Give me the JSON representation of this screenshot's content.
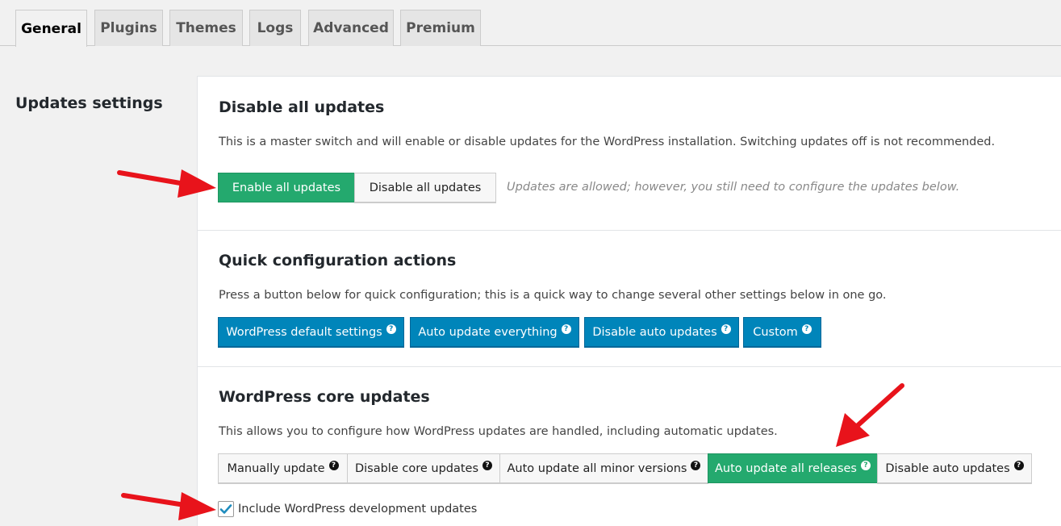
{
  "tabs": [
    "General",
    "Plugins",
    "Themes",
    "Logs",
    "Advanced",
    "Premium"
  ],
  "section_label": "Updates settings",
  "disable_all": {
    "title": "Disable all updates",
    "description": "This is a master switch and will enable or disable updates for the WordPress installation. Switching updates off is not recommended.",
    "enable_label": "Enable all updates",
    "disable_label": "Disable all updates",
    "hint": "Updates are allowed; however, you still need to configure the updates below."
  },
  "quick_config": {
    "title": "Quick configuration actions",
    "description": "Press a button below for quick configuration; this is a quick way to change several other settings below in one go.",
    "buttons": [
      "WordPress default settings",
      "Auto update everything",
      "Disable auto updates",
      "Custom"
    ]
  },
  "core_updates": {
    "title": "WordPress core updates",
    "description": "This allows you to configure how WordPress updates are handled, including automatic updates.",
    "options": [
      "Manually update",
      "Disable core updates",
      "Auto update all minor versions",
      "Auto update all releases",
      "Disable auto updates"
    ],
    "selected": "Auto update all releases",
    "checkbox_label": "Include WordPress development updates",
    "checkbox_checked": true
  },
  "colors": {
    "green": "#24a96e",
    "blue": "#0085ba",
    "arrow": "#e8131b"
  }
}
